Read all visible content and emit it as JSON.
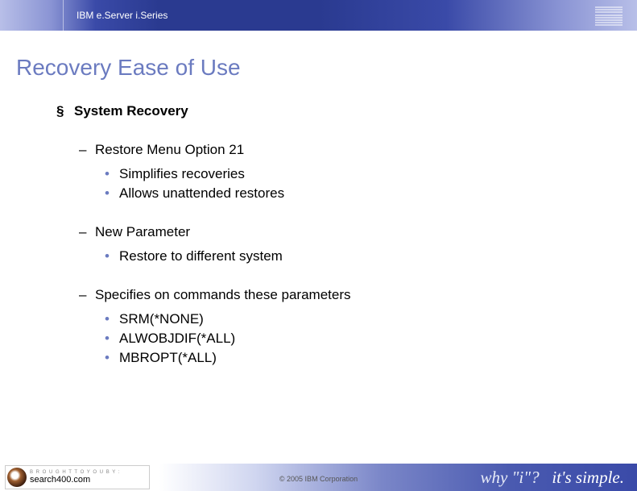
{
  "header": {
    "product": "IBM e.Server i.Series"
  },
  "title": "Recovery Ease of Use",
  "section": {
    "heading": "System Recovery",
    "groups": [
      {
        "label": "Restore Menu Option 21",
        "items": [
          "Simplifies recoveries",
          "Allows unattended restores"
        ]
      },
      {
        "label": "New Parameter",
        "items": [
          "Restore to different system"
        ]
      },
      {
        "label": "Specifies on commands these parameters",
        "items": [
          "SRM(*NONE)",
          "ALWOBJDIF(*ALL)",
          "MBROPT(*ALL)"
        ]
      }
    ]
  },
  "footer": {
    "copyright": "© 2005 IBM Corporation",
    "badge_top": "B R O U G H T   T O   Y O U   B Y :",
    "badge_main": "search400.com",
    "tagline_a": "why \"i\"?",
    "tagline_b": "it's simple."
  }
}
